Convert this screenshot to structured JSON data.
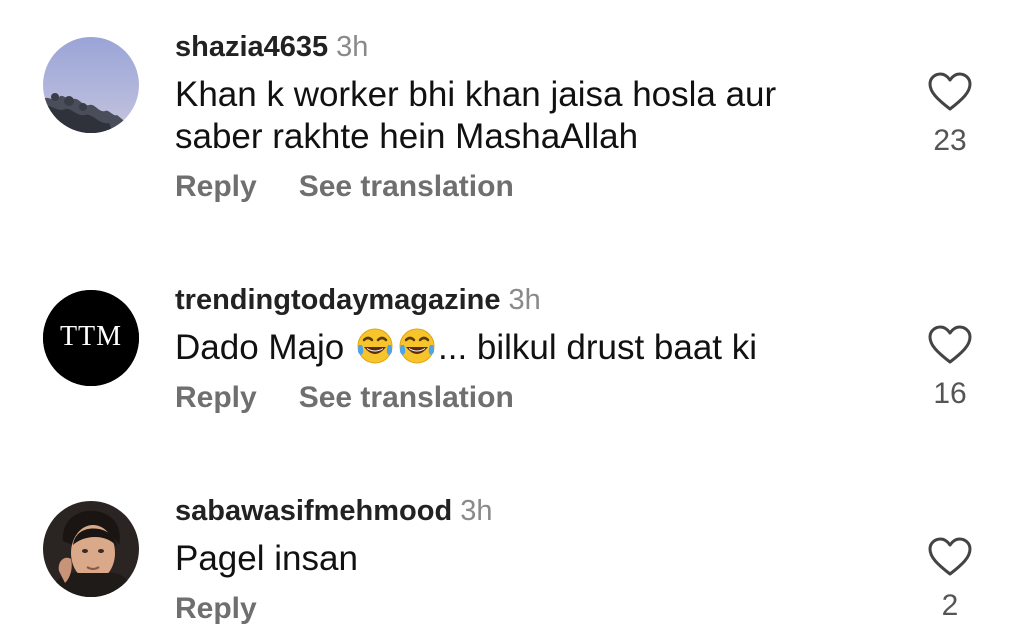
{
  "comments": [
    {
      "username": "shazia4635",
      "time": "3h",
      "text": "Khan k worker bhi khan jaisa hosla aur saber rakhte hein MashaAllah",
      "reply_label": "Reply",
      "translate_label": "See translation",
      "likes": "23",
      "avatar_icon": "sky-landscape-avatar"
    },
    {
      "username": "trendingtodaymagazine",
      "time": "3h",
      "text_before": "Dado Majo",
      "text_after": "... bilkul drust baat ki",
      "emoji_icon": "face-with-tears-of-joy-icon",
      "reply_label": "Reply",
      "translate_label": "See translation",
      "likes": "16",
      "avatar_text": "TTM"
    },
    {
      "username": "sabawasifmehmood",
      "time": "3h",
      "text": "Pagel insan",
      "reply_label": "Reply",
      "likes": "2",
      "avatar_icon": "person-photo-avatar"
    }
  ],
  "colors": {
    "text": "#111111",
    "muted": "#8a8a8a",
    "action": "#6f6f6f",
    "ttm_avatar_bg": "#000000"
  }
}
